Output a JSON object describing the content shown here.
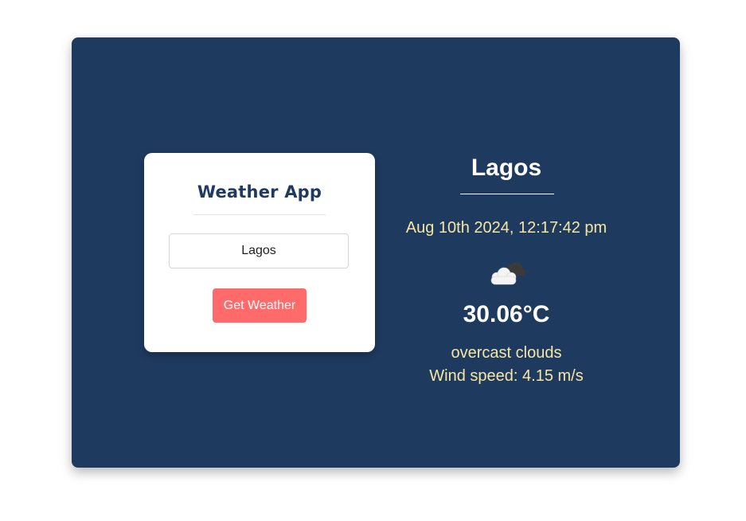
{
  "app": {
    "title": "Weather App"
  },
  "search": {
    "value": "Lagos",
    "button_label": "Get Weather"
  },
  "weather": {
    "city": "Lagos",
    "datetime": "Aug 10th 2024, 12:17:42 pm",
    "icon": "overcast-clouds-icon",
    "temperature": "30.06°C",
    "description": "overcast clouds",
    "wind": "Wind speed: 4.15 m/s"
  },
  "colors": {
    "panel_background": "#1f3a5f",
    "button": "#ff6b6b",
    "accent_text": "#f5e6a3",
    "card_background": "#ffffff"
  }
}
